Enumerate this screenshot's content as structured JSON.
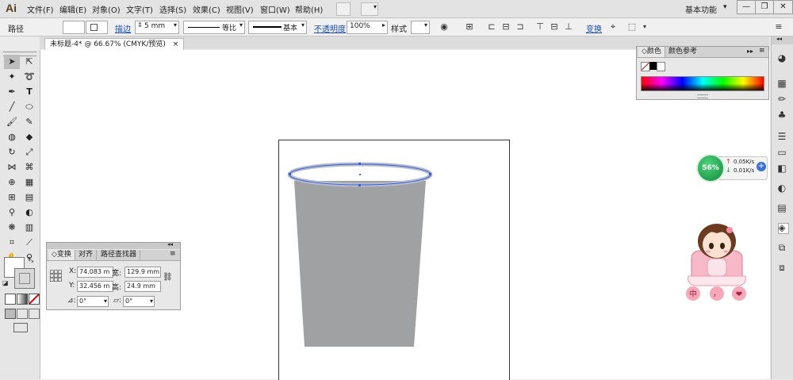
{
  "app": {
    "logo": "Ai"
  },
  "menu": [
    "文件(F)",
    "编辑(E)",
    "对象(O)",
    "文字(T)",
    "选择(S)",
    "效果(C)",
    "视图(V)",
    "窗口(W)",
    "帮助(H)"
  ],
  "workspace": "基本功能",
  "window_controls": {
    "minimize": "—",
    "restore": "❐",
    "close": "✕"
  },
  "control_bar": {
    "object_type": "路径",
    "stroke_label": "描边",
    "stroke_value": "5 mm",
    "stroke_profile": "等比",
    "brush_style": "基本",
    "opacity_label": "不透明度",
    "opacity_value": "100%",
    "style_label": "样式",
    "transform_link": "变换"
  },
  "document_tab": {
    "title": "未标题-4* @ 66.67% (CMYK/预览)",
    "close": "×"
  },
  "color_panel": {
    "tabs": [
      "颜色",
      "颜色参考"
    ]
  },
  "transform_panel": {
    "tabs": [
      "变换",
      "对齐",
      "路径查找器"
    ],
    "x_label": "X:",
    "x_value": "74.083 m",
    "w_label": "宽:",
    "w_value": "129.9 mm",
    "y_label": "Y:",
    "y_value": "32.456 m",
    "h_label": "高:",
    "h_value": "24.9 mm",
    "rotate_value": "0°",
    "shear_value": "0°"
  },
  "net_widget": {
    "percent": "56%",
    "up": "0.05K/s",
    "down": "0.01K/s"
  },
  "mascot_text": [
    "中",
    "，",
    "❤"
  ],
  "colors": {
    "cup_fill": "#a0a1a2",
    "selection": "#3a5fcd",
    "accent_link": "#1a4db3"
  },
  "icons": [
    "selection-tool-icon",
    "direct-selection-icon",
    "magic-wand-icon",
    "lasso-icon",
    "pen-icon",
    "type-icon",
    "line-icon",
    "ellipse-icon",
    "paintbrush-icon",
    "pencil-icon",
    "blob-brush-icon",
    "eraser-icon",
    "rotate-icon",
    "scale-icon",
    "width-icon",
    "warp-icon",
    "shape-builder-icon",
    "perspective-icon",
    "mesh-icon",
    "gradient-icon",
    "eyedropper-icon",
    "blend-icon",
    "symbol-sprayer-icon",
    "graph-icon",
    "artboard-icon",
    "slice-icon",
    "hand-icon",
    "zoom-icon"
  ]
}
